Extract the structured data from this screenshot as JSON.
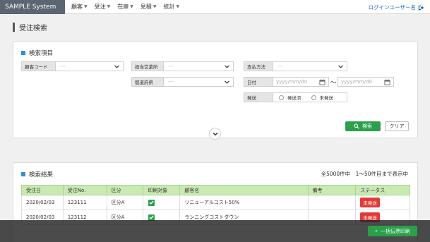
{
  "app": {
    "brand": "SAMPLE System"
  },
  "nav": {
    "items": [
      {
        "label": "顧客"
      },
      {
        "label": "受注"
      },
      {
        "label": "在庫"
      },
      {
        "label": "見積"
      },
      {
        "label": "統計"
      }
    ],
    "caret": "▼"
  },
  "user": {
    "label": "ログインユーザー名"
  },
  "page": {
    "title": "受注検索"
  },
  "search": {
    "title": "検索項目",
    "customer_code": {
      "label": "顧客コード",
      "value": "---"
    },
    "sales_office": {
      "label": "担当営業所",
      "value": "---"
    },
    "payment_method": {
      "label": "支払方法",
      "value": "---"
    },
    "prefecture": {
      "label": "都道府県",
      "value": "---"
    },
    "date": {
      "label": "日付",
      "from_placeholder": "yyyy/mm/dd",
      "to_placeholder": "yyyy/mm/dd",
      "separator": "〜"
    },
    "shipping": {
      "label": "発送",
      "options": [
        "発送済",
        "未発送"
      ]
    },
    "search_button": "検索",
    "clear_button": "クリア"
  },
  "results": {
    "title": "検索結果",
    "count_text": "全5000件中　1〜50件目まで表示中",
    "columns": [
      "受注日",
      "受注No.",
      "区分",
      "印刷対象",
      "顧客名",
      "備考",
      "ステータス"
    ],
    "rows": [
      {
        "date": "2020/02/03",
        "order_no": "123111",
        "category": "区分A",
        "print": true,
        "customer": "リニューアルコスト50%",
        "note": "",
        "status": "未発送"
      },
      {
        "date": "2020/02/03",
        "order_no": "123112",
        "category": "区分A",
        "print": true,
        "customer": "ランニングコストダウン",
        "note": "",
        "status": "未発送"
      }
    ]
  },
  "footer": {
    "bulk_print_button": "一括伝票印刷",
    "bulk_print_icon": "»"
  },
  "colors": {
    "accent_green": "#2aa04a",
    "accent_blue": "#2b8fd9",
    "status_red": "#e53935",
    "table_header": "#c9eab2",
    "brand_bg": "#5b6672"
  }
}
